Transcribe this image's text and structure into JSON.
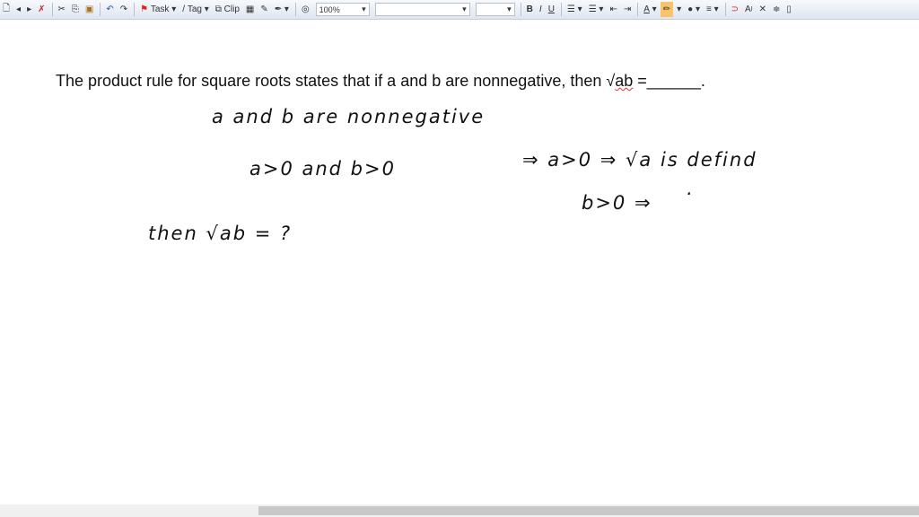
{
  "toolbar": {
    "task_label": "Task",
    "tag_label": "Tag",
    "clip_label": "Clip",
    "zoom_value": "100%",
    "font_value": "",
    "size_value": "",
    "bold": "B",
    "italic": "I",
    "underline": "U",
    "font_color": "A",
    "superscript": "A",
    "highlight_color": "#f7c46a"
  },
  "document": {
    "question_before": "The product rule for square roots states that if a and b are nonnegative, then √",
    "question_ab": "ab",
    "question_after": " =______."
  },
  "handwriting": {
    "line1": "a and b are nonnegative",
    "line2": "a>0  and b>0",
    "line3": "⇒ a>0 ⇒ √a  is defind",
    "line4": "b>0 ⇒",
    "dot": "·",
    "line5": "then  √ab  = ?"
  }
}
